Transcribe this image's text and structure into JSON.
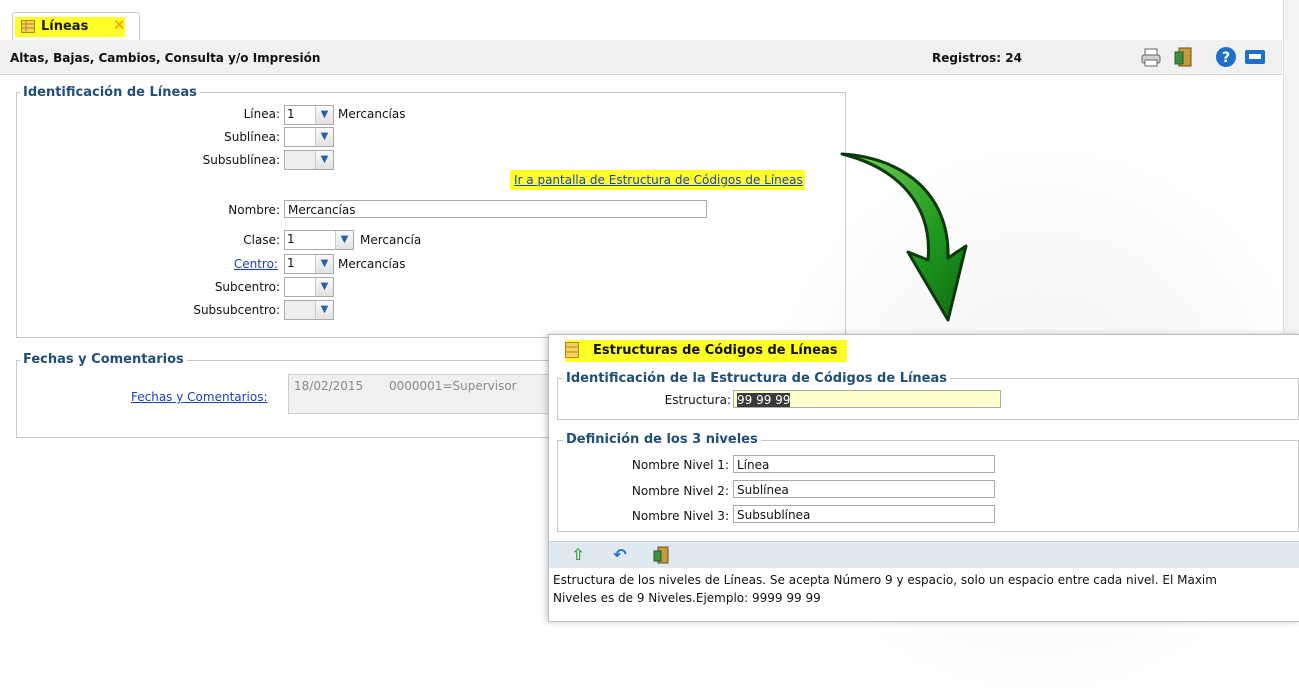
{
  "tab": {
    "label": "Líneas",
    "close": "✕"
  },
  "header": {
    "title": "Altas, Bajas, Cambios, Consulta y/o Impresión",
    "records": "Registros: 24",
    "icons": [
      "printer-icon",
      "exit-door-icon",
      "help-icon",
      "keyboard-icon"
    ]
  },
  "identificacion": {
    "legend": "Identificación de Líneas",
    "linea_label": "Línea:",
    "linea_value": "1",
    "linea_desc": "Mercancías",
    "sublinea_label": "Sublínea:",
    "sublinea_value": "",
    "subsublinea_label": "Subsublínea:",
    "subsublinea_value": "",
    "estructura_link": "Ir a pantalla de Estructura de Códigos de Líneas",
    "nombre_label": "Nombre:",
    "nombre_value": "Mercancías",
    "clase_label": "Clase:",
    "clase_value": "1",
    "clase_desc": "Mercancía",
    "centro_label": "Centro:",
    "centro_value": "1",
    "centro_desc": "Mercancías",
    "subcentro_label": "Subcentro:",
    "subcentro_value": "",
    "subsubcentro_label": "Subsubcentro:",
    "subsubcentro_value": ""
  },
  "fechas": {
    "legend": "Fechas y Comentarios",
    "link": "Fechas y Comentarios:",
    "date": "18/02/2015",
    "user": "0000001=Supervisor"
  },
  "popup": {
    "title": "Estructuras de Códigos de Líneas",
    "ident_legend": "Identificación  de la Estructura de Códigos de Líneas",
    "estructura_label": "Estructura:",
    "estructura_value": "99 99 99",
    "def_legend": "Definición de los 3 niveles",
    "nivel1_label": "Nombre Nivel 1:",
    "nivel1_value": "Línea",
    "nivel2_label": "Nombre Nivel 2:",
    "nivel2_value": "Sublínea",
    "nivel3_label": "Nombre Nivel 3:",
    "nivel3_value": "Subsublínea",
    "toolbar_icons": [
      "accept-arrow-icon",
      "undo-icon",
      "exit-door-icon"
    ],
    "status_line1": "Estructura de los niveles de Líneas. Se acepta Número 9 y espacio, solo un espacio entre cada nivel. El Maxim",
    "status_line2": "Niveles es de 9 Niveles.Ejemplo: 9999 99 99"
  },
  "colors": {
    "highlight": "#ffff28",
    "legend_text": "#1f4e79",
    "link": "#1a3fbf",
    "arrow_green": "#1f9a1f"
  }
}
